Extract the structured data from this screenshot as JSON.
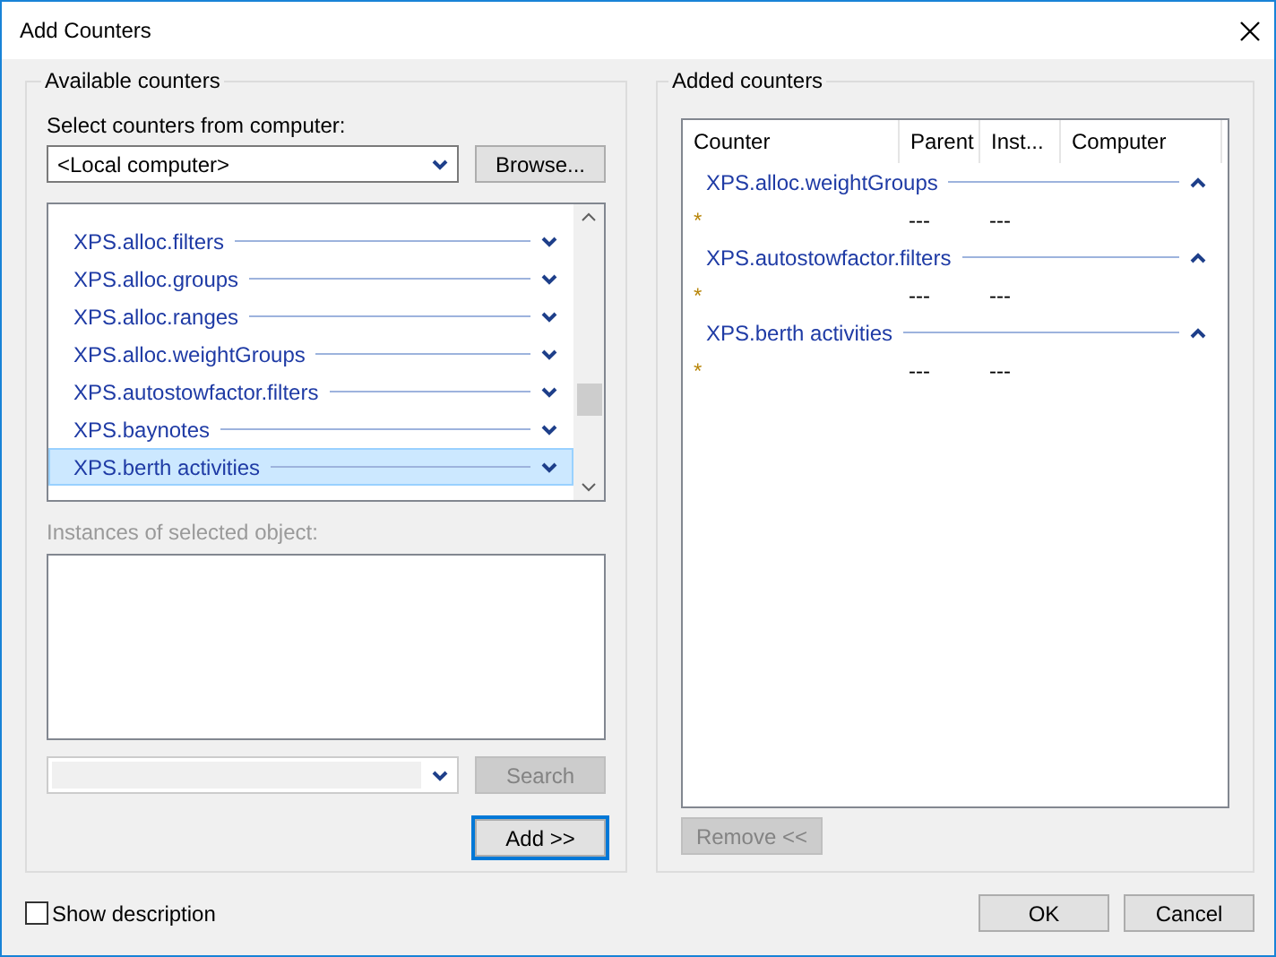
{
  "window": {
    "title": "Add Counters"
  },
  "available": {
    "title": "Available counters",
    "computer_label": "Select counters from computer:",
    "computer_value": "<Local computer>",
    "browse_button": "Browse...",
    "items": [
      {
        "label": "XPS.alloc.filters",
        "selected": false,
        "expanded": false
      },
      {
        "label": "XPS.alloc.groups",
        "selected": false,
        "expanded": false
      },
      {
        "label": "XPS.alloc.ranges",
        "selected": false,
        "expanded": false
      },
      {
        "label": "XPS.alloc.weightGroups",
        "selected": false,
        "expanded": false
      },
      {
        "label": "XPS.autostowfactor.filters",
        "selected": false,
        "expanded": false
      },
      {
        "label": "XPS.baynotes",
        "selected": false,
        "expanded": false
      },
      {
        "label": "XPS.berth activities",
        "selected": true,
        "expanded": false
      }
    ],
    "instances_label": {
      "text": "Instances of selected object:",
      "disabled": true
    },
    "search_button": {
      "label": "Search",
      "disabled": true
    },
    "add_button": {
      "label": "Add >>",
      "disabled": false
    }
  },
  "added": {
    "title": "Added counters",
    "columns": [
      "Counter",
      "Parent",
      "Inst...",
      "Computer"
    ],
    "groups": [
      {
        "label": "XPS.alloc.weightGroups",
        "expanded": true,
        "rows": [
          [
            "*",
            "---",
            "---"
          ]
        ]
      },
      {
        "label": "XPS.autostowfactor.filters",
        "expanded": true,
        "rows": [
          [
            "*",
            "---",
            "---"
          ]
        ]
      },
      {
        "label": "XPS.berth activities",
        "expanded": true,
        "rows": [
          [
            "*",
            "---",
            "---"
          ]
        ]
      }
    ],
    "remove_button": {
      "label": "Remove <<",
      "disabled": true
    }
  },
  "show_description": {
    "label": "Show description",
    "checked": false
  },
  "buttons": [
    "OK",
    "Cancel"
  ]
}
